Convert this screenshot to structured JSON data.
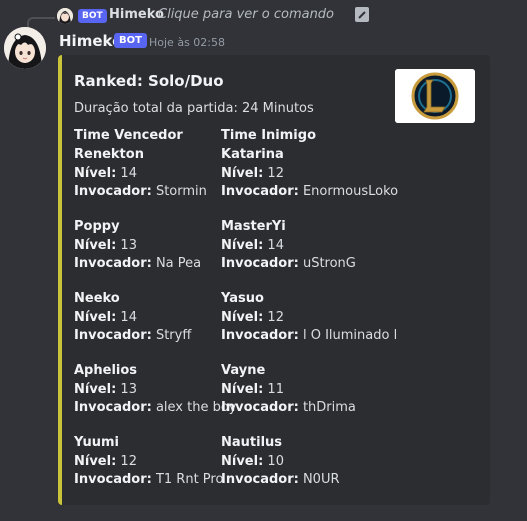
{
  "reply": {
    "bot_tag": "BOT",
    "username": "Himeko",
    "text": "Clique para ver o comando"
  },
  "message": {
    "username": "Himeko",
    "bot_tag": "BOT",
    "timestamp": "Hoje às 02:58"
  },
  "embed": {
    "accent_color": "#c9c439",
    "title": "Ranked: Solo/Duo",
    "description": "Duração total da partida: 24 Minutos",
    "winner_header": "Time Vencedor",
    "enemy_header": "Time Inimigo",
    "level_label": "Nível:",
    "summoner_label": "Invocador:",
    "winners": [
      {
        "champion": "Renekton",
        "level": "14",
        "summoner": "Stormin"
      },
      {
        "champion": "Poppy",
        "level": "13",
        "summoner": "Na Pea"
      },
      {
        "champion": "Neeko",
        "level": "14",
        "summoner": "Stryff"
      },
      {
        "champion": "Aphelios",
        "level": "13",
        "summoner": "alex the boy"
      },
      {
        "champion": "Yuumi",
        "level": "12",
        "summoner": "T1 Rnt Pro"
      }
    ],
    "enemies": [
      {
        "champion": "Katarina",
        "level": "12",
        "summoner": "EnormousLoko"
      },
      {
        "champion": "MasterYi",
        "level": "14",
        "summoner": "uStronG"
      },
      {
        "champion": "Yasuo",
        "level": "12",
        "summoner": "l O Iluminado l"
      },
      {
        "champion": "Vayne",
        "level": "11",
        "summoner": "thDrima"
      },
      {
        "champion": "Nautilus",
        "level": "10",
        "summoner": "N0UR"
      }
    ]
  },
  "icons": {
    "reply_avatar": "anime-avatar-icon",
    "command_icon": "slash-command-icon",
    "avatar": "anime-avatar-icon",
    "thumbnail": "league-of-legends-logo-icon"
  }
}
